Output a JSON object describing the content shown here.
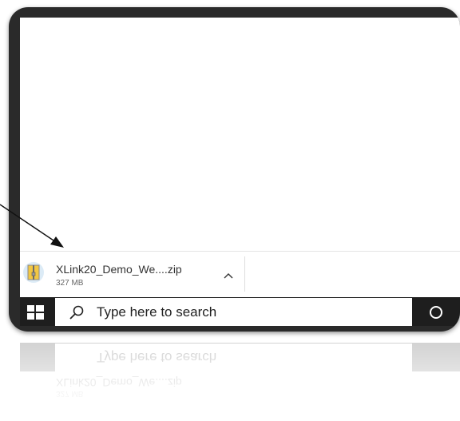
{
  "download_bar": {
    "file_name": "XLink20_Demo_We....zip",
    "file_size": "327 MB",
    "icon": "zip-archive-icon",
    "expand_icon": "chevron-up-icon"
  },
  "taskbar": {
    "start_icon": "windows-start-icon",
    "search": {
      "icon": "search-icon",
      "placeholder": "Type here to search"
    },
    "cortana_icon": "cortana-circle-icon"
  },
  "colors": {
    "bezel": "#2a2a2a",
    "taskbar": "#1e1e1e",
    "search_bg": "#ffffff",
    "icon_bg": "#dcebf6",
    "zip_yellow": "#f2c744"
  }
}
